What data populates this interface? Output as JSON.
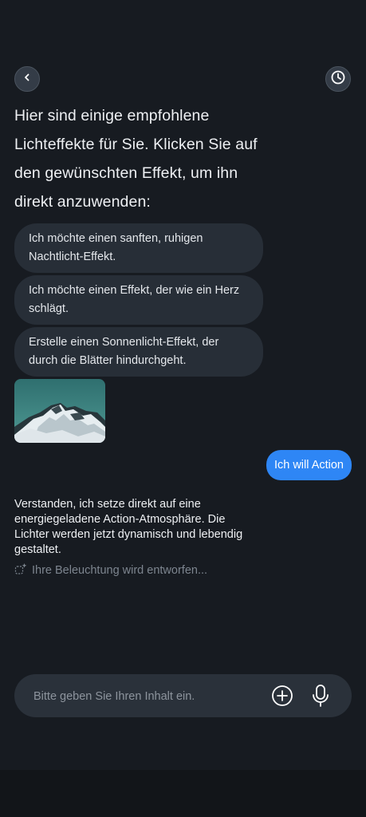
{
  "header": {
    "back_icon": "chevron-left-icon",
    "history_icon": "clock-icon"
  },
  "assistant": {
    "intro": "Hier sind einige empfohlene Lichteffekte für Sie. Klicken Sie auf den gewünschten Effekt, um ihn direkt anzuwenden:",
    "suggestions": [
      "Ich möchte einen sanften, ruhigen Nachtlicht-Effekt.",
      "Ich möchte einen Effekt, der wie ein Herz schlägt.",
      "Erstelle einen Sonnenlicht-Effekt, der durch die Blätter hindurchgeht."
    ],
    "reply": "Verstanden, ich setze direkt auf eine energiegeladene Action-Atmosphäre. Die Lichter werden jetzt dynamisch und lebendig gestaltet.",
    "status": "Ihre Beleuchtung wird entworfen..."
  },
  "user": {
    "message": "Ich will Action"
  },
  "composer": {
    "placeholder": "Bitte geben Sie Ihren Inhalt ein.",
    "add_icon": "plus-circle-icon",
    "mic_icon": "microphone-icon"
  },
  "colors": {
    "background": "#171b21",
    "bubble_user": "#2e86f5",
    "chip": "#272e37",
    "input": "#2a313a"
  }
}
